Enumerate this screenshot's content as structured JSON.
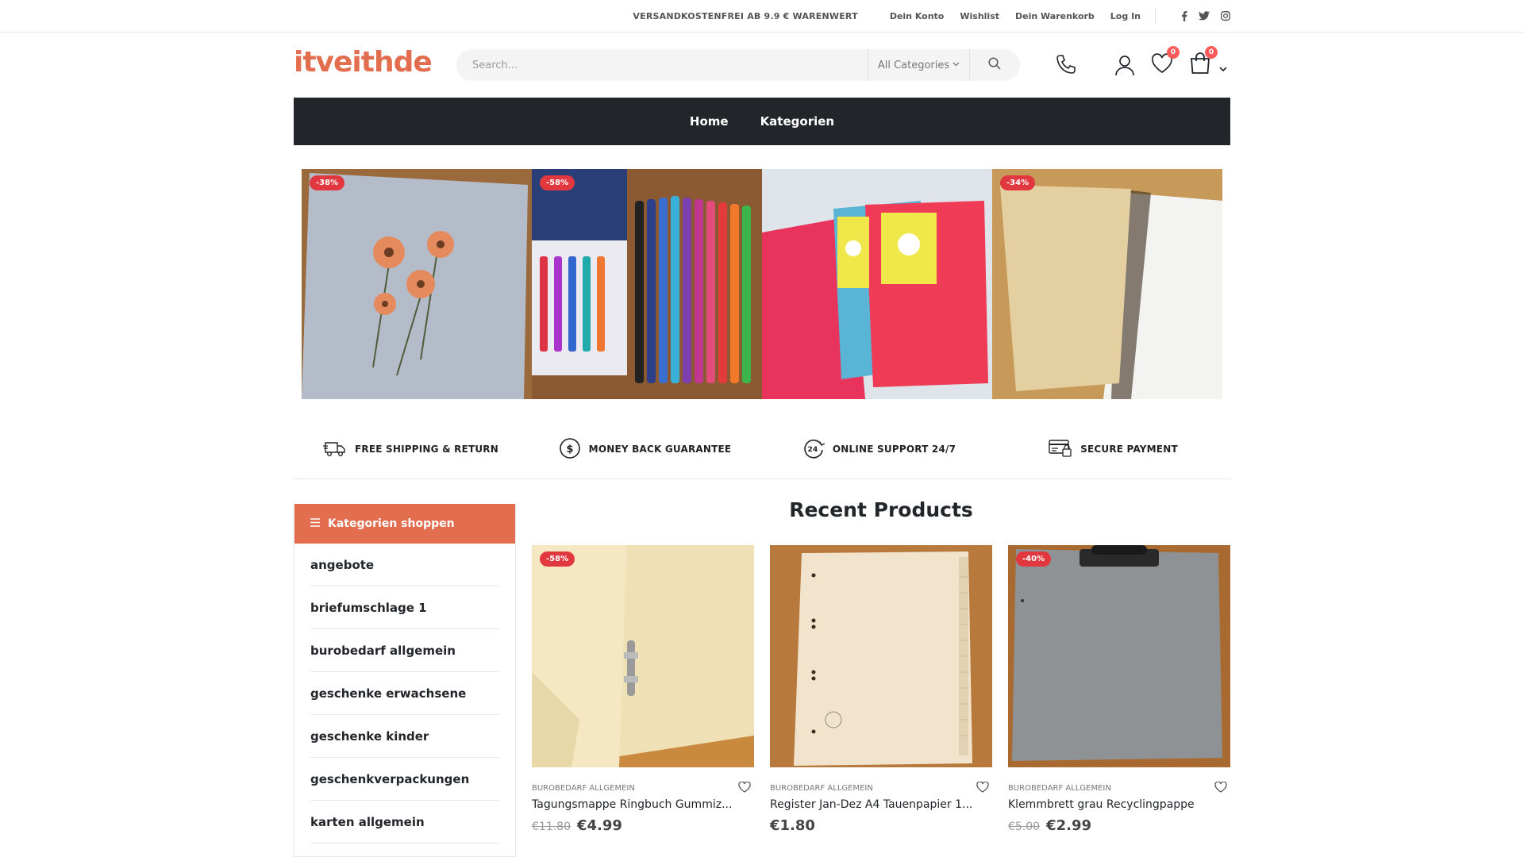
{
  "topbar": {
    "promo": "VERSANDKOSTENFREI AB 9.9 € WARENWERT",
    "links": [
      "Dein Konto",
      "Wishlist",
      "Dein Warenkorb",
      "Log In"
    ],
    "social": [
      "facebook-icon",
      "twitter-icon",
      "instagram-icon"
    ]
  },
  "header": {
    "logo": "itveithde",
    "search_placeholder": "Search...",
    "category_select": "All Categories",
    "wishlist_count": "0",
    "cart_count": "0"
  },
  "nav": {
    "items": [
      "Home",
      "Kategorien"
    ]
  },
  "banner": {
    "tiles": [
      {
        "discount": "-38%"
      },
      {
        "discount": "-58%"
      },
      {
        "discount": ""
      },
      {
        "discount": "-34%"
      }
    ]
  },
  "features": [
    {
      "label": "FREE SHIPPING & RETURN",
      "icon": "truck-icon"
    },
    {
      "label": "MONEY BACK GUARANTEE",
      "icon": "dollar-circle-icon"
    },
    {
      "label": "ONLINE SUPPORT 24/7",
      "icon": "support-24-icon"
    },
    {
      "label": "SECURE PAYMENT",
      "icon": "secure-card-icon"
    }
  ],
  "sidebar": {
    "title": "Kategorien shoppen",
    "items": [
      "angebote",
      "briefumschlage 1",
      "burobedarf allgemein",
      "geschenke erwachsene",
      "geschenke kinder",
      "geschenkverpackungen",
      "karten allgemein"
    ]
  },
  "products_section": {
    "title": "Recent Products",
    "items": [
      {
        "discount": "-58%",
        "category": "BUROBEDARF ALLGEMEIN",
        "name": "Tagungsmappe Ringbuch Gummiz...",
        "old_price": "€11.80",
        "price": "€4.99"
      },
      {
        "discount": "",
        "category": "BUROBEDARF ALLGEMEIN",
        "name": "Register Jan-Dez A4 Tauenpapier 1...",
        "old_price": "",
        "price": "€1.80"
      },
      {
        "discount": "-40%",
        "category": "BUROBEDARF ALLGEMEIN",
        "name": "Klemmbrett grau Recyclingpappe",
        "old_price": "€5.00",
        "price": "€2.99"
      }
    ]
  },
  "colors": {
    "brand": "#e36d4f",
    "nav_bg": "#222529",
    "discount_badge": "#e0383e"
  }
}
